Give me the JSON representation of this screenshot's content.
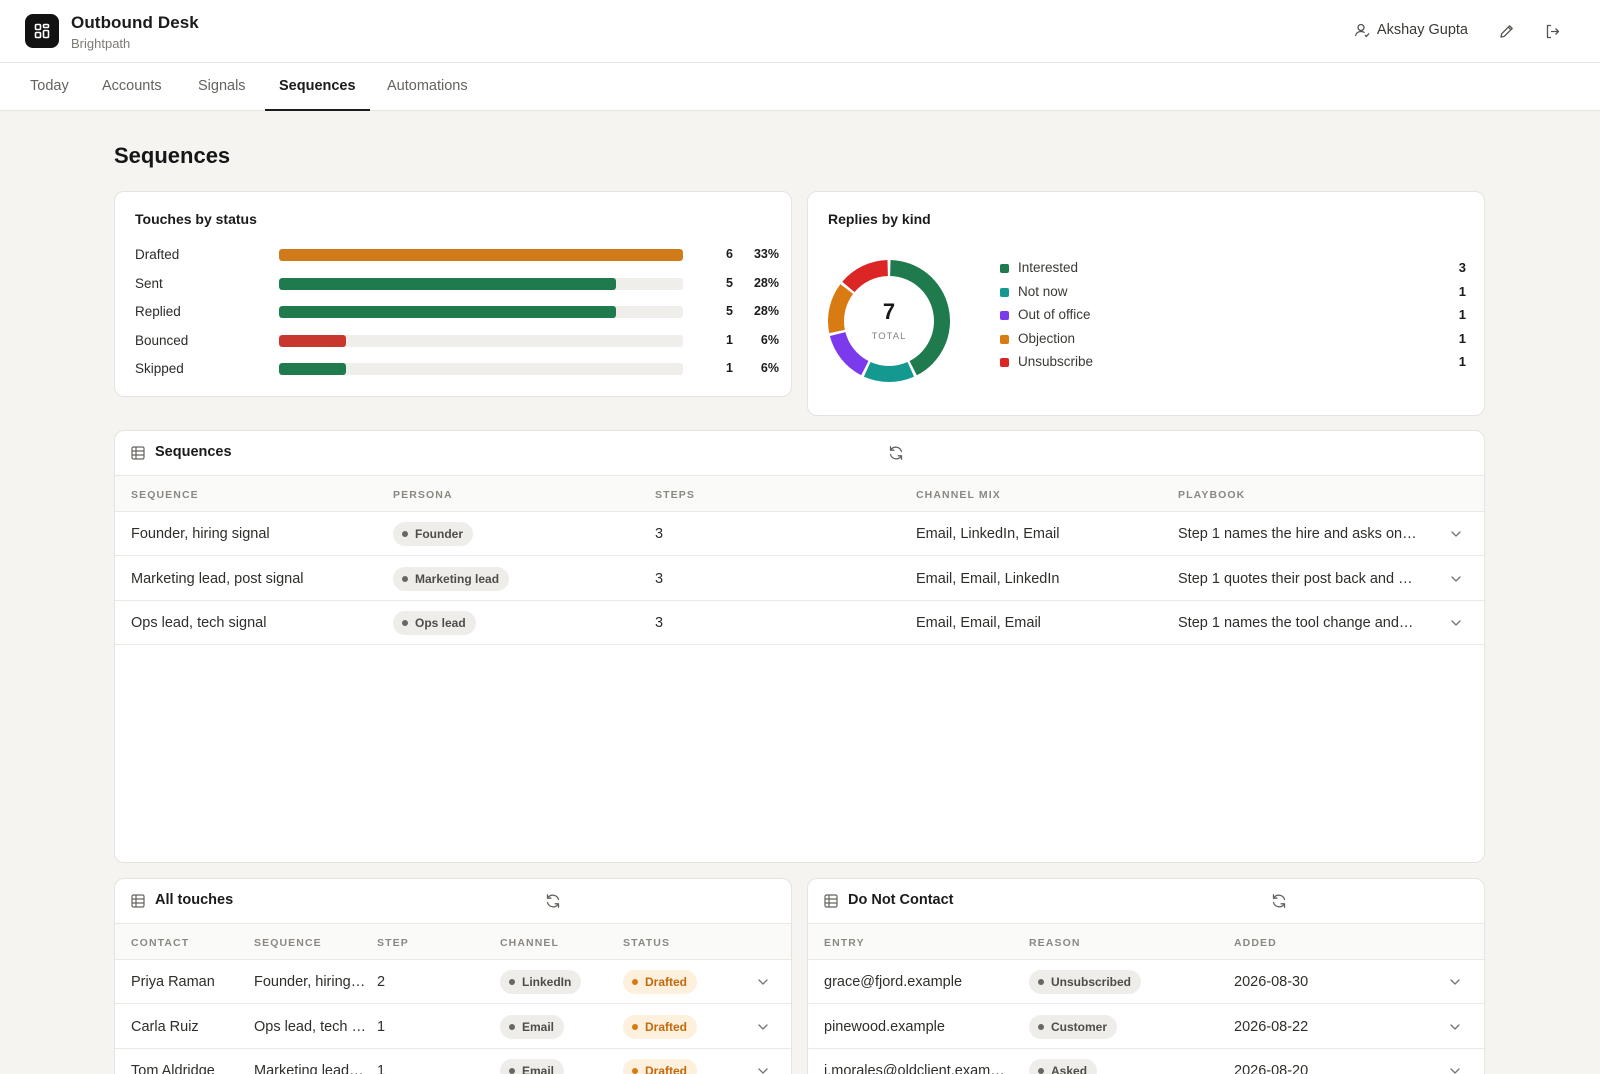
{
  "app": {
    "title": "Outbound Desk",
    "subtitle": "Brightpath",
    "user": "Akshay Gupta"
  },
  "tabs": [
    {
      "label": "Today",
      "active": false
    },
    {
      "label": "Accounts",
      "active": false
    },
    {
      "label": "Signals",
      "active": false
    },
    {
      "label": "Sequences",
      "active": true
    },
    {
      "label": "Automations",
      "active": false
    }
  ],
  "page": {
    "title": "Sequences"
  },
  "touches_by_status": {
    "title": "Touches by status",
    "rows": [
      {
        "label": "Drafted",
        "count": "6",
        "pct": "33%",
        "fraction": 1.0,
        "color": "#d07a1a"
      },
      {
        "label": "Sent",
        "count": "5",
        "pct": "28%",
        "fraction": 0.833,
        "color": "#1f7a4d"
      },
      {
        "label": "Replied",
        "count": "5",
        "pct": "28%",
        "fraction": 0.833,
        "color": "#1f7a4d"
      },
      {
        "label": "Bounced",
        "count": "1",
        "pct": "6%",
        "fraction": 0.167,
        "color": "#c8372d"
      },
      {
        "label": "Skipped",
        "count": "1",
        "pct": "6%",
        "fraction": 0.167,
        "color": "#1f7a4d"
      }
    ]
  },
  "replies_by_kind": {
    "title": "Replies by kind",
    "total": "7",
    "total_caption": "TOTAL",
    "items": [
      {
        "label": "Interested",
        "value": "3",
        "color": "#1f7a4d"
      },
      {
        "label": "Not now",
        "value": "1",
        "color": "#13998f"
      },
      {
        "label": "Out of office",
        "value": "1",
        "color": "#7c3aed"
      },
      {
        "label": "Objection",
        "value": "1",
        "color": "#d97b13"
      },
      {
        "label": "Unsubscribe",
        "value": "1",
        "color": "#dc2626"
      }
    ]
  },
  "sequences_table": {
    "title": "Sequences",
    "columns": [
      "SEQUENCE",
      "PERSONA",
      "STEPS",
      "CHANNEL MIX",
      "PLAYBOOK"
    ],
    "rows": [
      {
        "sequence": "Founder, hiring signal",
        "persona": "Founder",
        "steps": "3",
        "channel_mix": "Email, LinkedIn, Email",
        "playbook": "Step 1 names the hire and asks on…"
      },
      {
        "sequence": "Marketing lead, post signal",
        "persona": "Marketing lead",
        "steps": "3",
        "channel_mix": "Email, Email, LinkedIn",
        "playbook": "Step 1 quotes their post back and …"
      },
      {
        "sequence": "Ops lead, tech signal",
        "persona": "Ops lead",
        "steps": "3",
        "channel_mix": "Email, Email, Email",
        "playbook": "Step 1 names the tool change and…"
      }
    ]
  },
  "touches_table": {
    "title": "All touches",
    "columns": [
      "CONTACT",
      "SEQUENCE",
      "STEP",
      "CHANNEL",
      "STATUS"
    ],
    "rows": [
      {
        "contact": "Priya Raman",
        "sequence": "Founder, hiring…",
        "step": "2",
        "channel": "LinkedIn",
        "status": "Drafted"
      },
      {
        "contact": "Carla Ruiz",
        "sequence": "Ops lead, tech …",
        "step": "1",
        "channel": "Email",
        "status": "Drafted"
      },
      {
        "contact": "Tom Aldridge",
        "sequence": "Marketing lead…",
        "step": "1",
        "channel": "Email",
        "status": "Drafted"
      }
    ]
  },
  "dnc_table": {
    "title": "Do Not Contact",
    "columns": [
      "ENTRY",
      "REASON",
      "ADDED"
    ],
    "rows": [
      {
        "entry": "grace@fjord.example",
        "reason": "Unsubscribed",
        "added": "2026-08-30"
      },
      {
        "entry": "pinewood.example",
        "reason": "Customer",
        "added": "2026-08-22"
      },
      {
        "entry": "j.morales@oldclient.exam…",
        "reason": "Asked",
        "added": "2026-08-20"
      }
    ]
  }
}
